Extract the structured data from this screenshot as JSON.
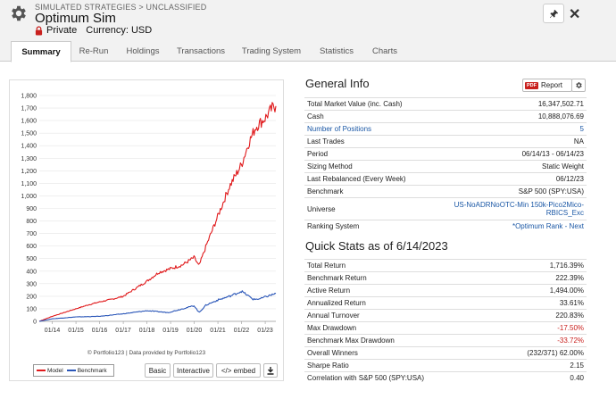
{
  "header": {
    "breadcrumb": "SIMULATED STRATEGIES > UNCLASSIFIED",
    "title": "Optimum Sim",
    "privacy": "Private",
    "currency": "Currency: USD"
  },
  "tabs": [
    {
      "label": "Summary"
    },
    {
      "label": "Re-Run"
    },
    {
      "label": "Holdings"
    },
    {
      "label": "Transactions"
    },
    {
      "label": "Trading System"
    },
    {
      "label": "Statistics"
    },
    {
      "label": "Charts"
    }
  ],
  "general_info": {
    "title": "General Info",
    "report_label": "Report",
    "pdf_label": "PDF",
    "rows": [
      {
        "label": "Total Market Value (inc. Cash)",
        "value": "16,347,502.71"
      },
      {
        "label": "Cash",
        "value": "10,888,076.69"
      },
      {
        "label": "Number of Positions",
        "value": "5"
      },
      {
        "label": "Last Trades",
        "value": "NA"
      },
      {
        "label": "Period",
        "value": "06/14/13 - 06/14/23"
      },
      {
        "label": "Sizing Method",
        "value": "Static Weight"
      },
      {
        "label": "Last Rebalanced (Every Week)",
        "value": "06/12/23"
      },
      {
        "label": "Benchmark",
        "value": "S&P 500 (SPY:USA)"
      },
      {
        "label": "Universe",
        "value": "US-NoADRNoOTC-Min 150k-Pico2Mico-",
        "value2": "RBICS_Exc"
      },
      {
        "label": "Ranking System",
        "value": "*Optimum Rank - Next"
      }
    ]
  },
  "quick_stats": {
    "title": "Quick Stats as of 6/14/2023",
    "rows": [
      {
        "label": "Total Return",
        "value": "1,716.39%"
      },
      {
        "label": "Benchmark Return",
        "value": "222.39%"
      },
      {
        "label": "Active Return",
        "value": "1,494.00%"
      },
      {
        "label": "Annualized Return",
        "value": "33.61%"
      },
      {
        "label": "Annual Turnover",
        "value": "220.83%"
      },
      {
        "label": "Max Drawdown",
        "value": "-17.50%"
      },
      {
        "label": "Benchmark Max Drawdown",
        "value": "-33.72%"
      },
      {
        "label": "Overall Winners",
        "value": "(232/371) 62.00%"
      },
      {
        "label": "Sharpe Ratio",
        "value": "2.15"
      },
      {
        "label": "Correlation with S&P 500 (SPY:USA)",
        "value": "0.40"
      }
    ]
  },
  "chart_controls": {
    "copyright": "© Portfolio123 | Data provided by Portfolio123",
    "basic": "Basic",
    "interactive": "Interactive",
    "embed": "</> embed"
  },
  "colors": {
    "model": "#e0191b",
    "benchmark": "#2a56b8",
    "negative": "#c9211e",
    "link": "#1a57a5"
  },
  "icons": [
    "gear-icon",
    "lock-icon",
    "pin-icon",
    "close-icon",
    "download-icon"
  ],
  "chart_data": {
    "type": "line",
    "ylim": [
      0,
      1800
    ],
    "y_ticks": [
      "0",
      "100",
      "200",
      "300",
      "400",
      "500",
      "600",
      "700",
      "800",
      "900",
      "1,000",
      "1,100",
      "1,200",
      "1,300",
      "1,400",
      "1,500",
      "1,600",
      "1,700",
      "1,800"
    ],
    "x_ticks": [
      "01/14",
      "01/15",
      "01/16",
      "01/17",
      "01/18",
      "01/19",
      "01/20",
      "01/21",
      "01/22",
      "01/23"
    ],
    "series": [
      {
        "name": "Model",
        "x": [
          2013.45,
          2014.0,
          2014.5,
          2015.0,
          2015.5,
          2016.0,
          2016.5,
          2017.0,
          2017.5,
          2018.0,
          2018.5,
          2019.0,
          2019.5,
          2020.0,
          2020.2,
          2020.5,
          2021.0,
          2021.5,
          2022.0,
          2022.3,
          2022.6,
          2023.0,
          2023.3,
          2023.45
        ],
        "values": [
          0,
          40,
          70,
          100,
          130,
          155,
          175,
          200,
          260,
          320,
          390,
          420,
          450,
          510,
          440,
          600,
          840,
          1080,
          1250,
          1420,
          1550,
          1620,
          1700,
          1716
        ]
      },
      {
        "name": "Benchmark",
        "x": [
          2013.45,
          2014.0,
          2015.0,
          2016.0,
          2017.0,
          2018.0,
          2018.9,
          2019.5,
          2020.0,
          2020.2,
          2020.5,
          2021.0,
          2021.5,
          2022.0,
          2022.5,
          2022.8,
          2023.0,
          2023.45
        ],
        "values": [
          0,
          20,
          35,
          40,
          60,
          85,
          70,
          100,
          125,
          70,
          130,
          170,
          200,
          240,
          175,
          180,
          195,
          222
        ]
      }
    ]
  }
}
